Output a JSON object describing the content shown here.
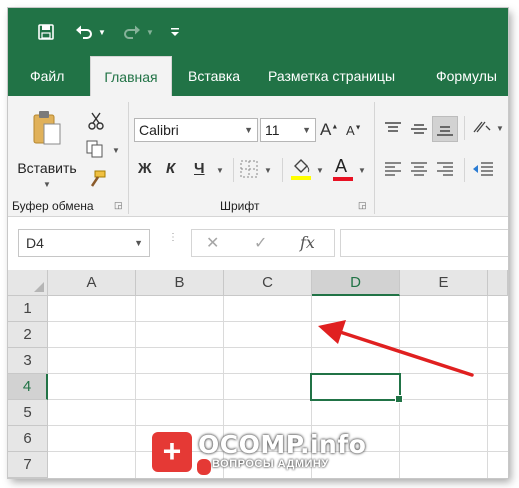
{
  "quick_access": {
    "save": "save-icon",
    "undo": "undo-icon",
    "redo": "redo-icon",
    "customize": "customize-qat-icon"
  },
  "tabs": [
    {
      "label": "Файл"
    },
    {
      "label": "Главная",
      "active": true
    },
    {
      "label": "Вставка"
    },
    {
      "label": "Разметка страницы"
    },
    {
      "label": "Формулы"
    }
  ],
  "ribbon": {
    "clipboard": {
      "paste_label": "Вставить",
      "group_label": "Буфер обмена"
    },
    "font": {
      "font_name": "Calibri",
      "font_size": "11",
      "bold": "Ж",
      "italic": "К",
      "underline": "Ч",
      "font_color_glyph": "A",
      "group_label": "Шрифт"
    },
    "colors": {
      "accent": "#217346",
      "highlight": "#ffff00",
      "font_color": "#e81123"
    }
  },
  "formula_bar": {
    "name_box": "D4",
    "cancel": "✕",
    "enter": "✓",
    "fx": "fx",
    "formula": ""
  },
  "sheet": {
    "columns": [
      "A",
      "B",
      "C",
      "D",
      "E"
    ],
    "rows": [
      "1",
      "2",
      "3",
      "4",
      "5",
      "6",
      "7"
    ],
    "selected_cell": "D4"
  },
  "annotation": {
    "arrow_color": "#e02020"
  },
  "watermark": {
    "badge": "+",
    "title": "OCOMP.info",
    "subtitle": "ВОПРОСЫ АДМИНУ"
  }
}
